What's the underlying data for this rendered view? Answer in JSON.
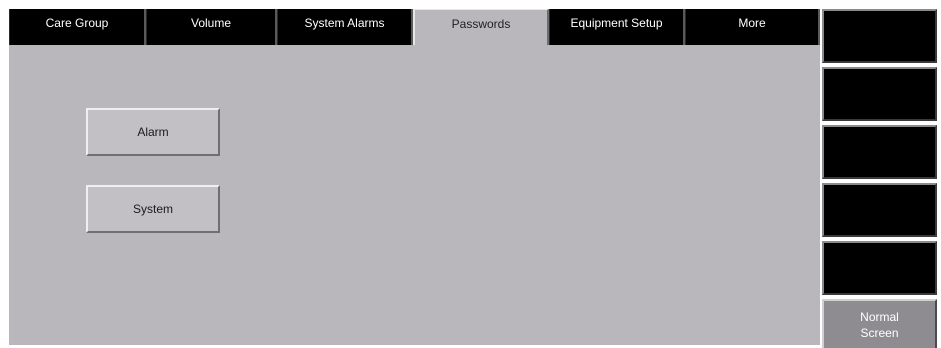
{
  "tabs": [
    {
      "label": "Care Group",
      "active": false
    },
    {
      "label": "Volume",
      "active": false
    },
    {
      "label": "System Alarms",
      "active": false
    },
    {
      "label": "Passwords",
      "active": true
    },
    {
      "label": "Equipment Setup",
      "active": false
    },
    {
      "label": "More",
      "active": false
    }
  ],
  "buttons": {
    "alarm": "Alarm",
    "system": "System"
  },
  "softkeys": {
    "normal_screen_line1": "Normal",
    "normal_screen_line2": "Screen"
  },
  "colors": {
    "panel_bg": "#b9b7bb",
    "tab_inactive_bg": "#000000",
    "tab_active_bg": "#b9b7bb",
    "softkey_bg": "#000000",
    "softkey_light_bg": "#8e8c90"
  }
}
